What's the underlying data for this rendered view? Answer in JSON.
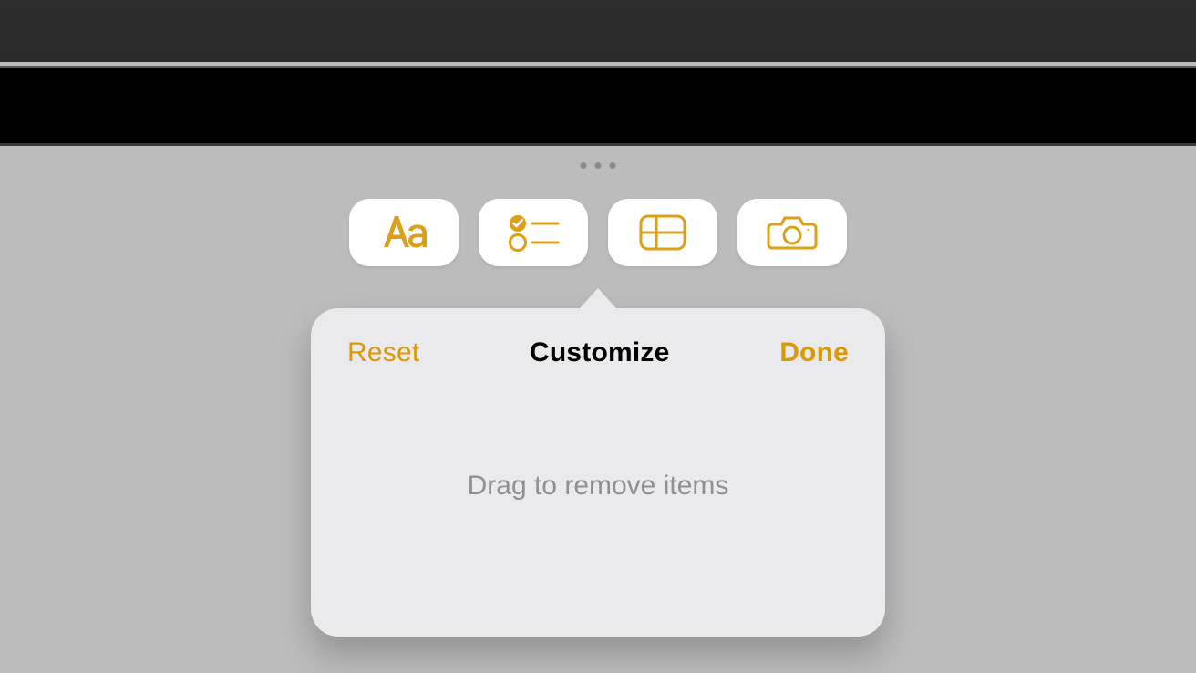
{
  "colors": {
    "accent": "#d99a07",
    "panel": "#eaeaec",
    "button_bg": "#ffffff"
  },
  "toolbar": {
    "items": [
      {
        "name": "text-format",
        "icon": "text-format-icon"
      },
      {
        "name": "checklist",
        "icon": "checklist-icon"
      },
      {
        "name": "table",
        "icon": "table-icon"
      },
      {
        "name": "camera",
        "icon": "camera-icon"
      }
    ]
  },
  "popover": {
    "reset_label": "Reset",
    "title": "Customize",
    "done_label": "Done",
    "hint": "Drag to remove items"
  }
}
